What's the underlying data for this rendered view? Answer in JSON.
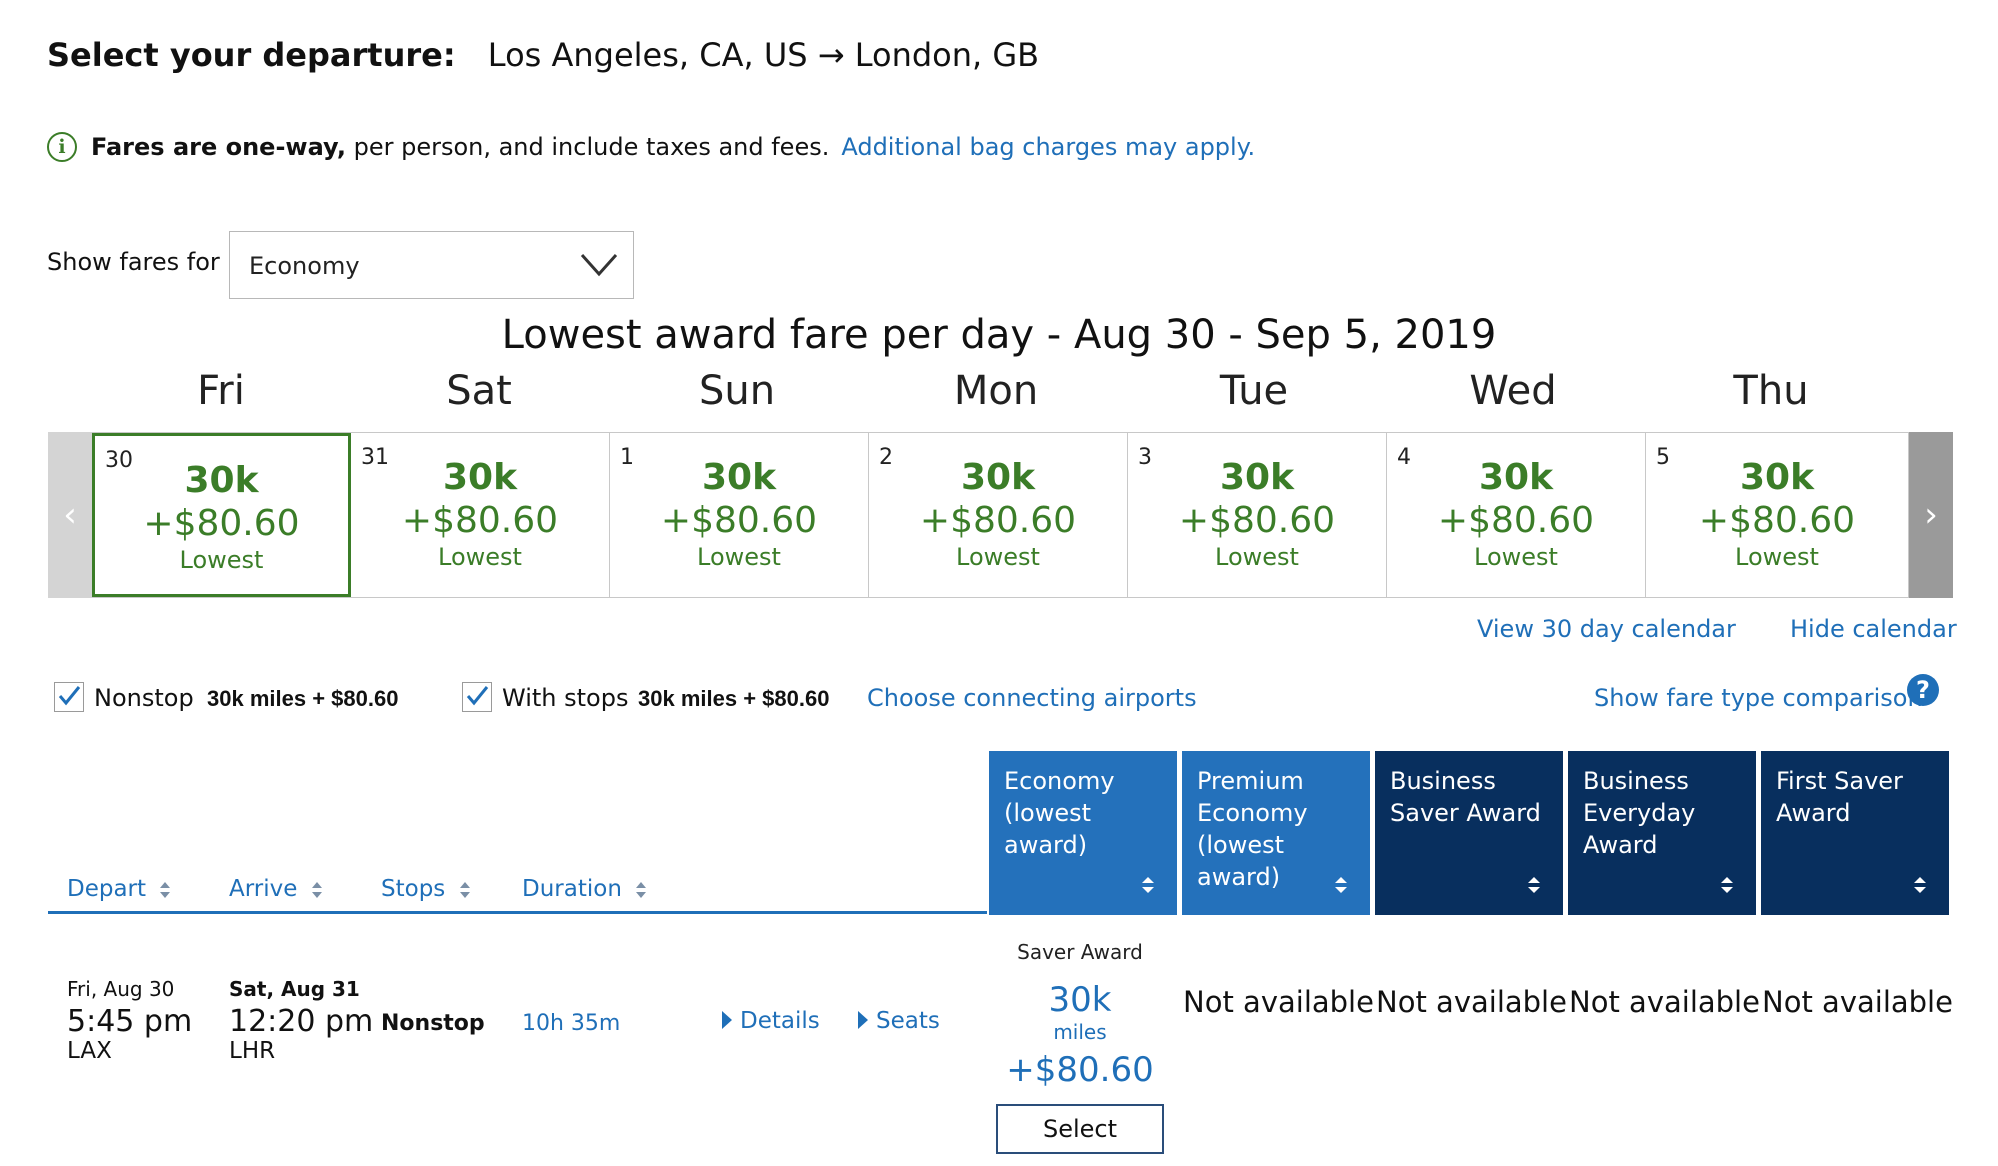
{
  "header": {
    "label": "Select your departure:",
    "route": "Los Angeles, CA, US → London, GB"
  },
  "info": {
    "bold": "Fares are one-way,",
    "text": " per person, and include taxes and fees.",
    "link": "Additional bag charges may apply."
  },
  "cabin": {
    "label": "Show fares for",
    "selected": "Economy"
  },
  "calendar": {
    "title": "Lowest award fare per day - Aug 30 - Sep 5, 2019",
    "days": [
      {
        "dow": "Fri",
        "date": "30",
        "miles": "30k",
        "fee": "+$80.60",
        "tag": "Lowest"
      },
      {
        "dow": "Sat",
        "date": "31",
        "miles": "30k",
        "fee": "+$80.60",
        "tag": "Lowest"
      },
      {
        "dow": "Sun",
        "date": "1",
        "miles": "30k",
        "fee": "+$80.60",
        "tag": "Lowest"
      },
      {
        "dow": "Mon",
        "date": "2",
        "miles": "30k",
        "fee": "+$80.60",
        "tag": "Lowest"
      },
      {
        "dow": "Tue",
        "date": "3",
        "miles": "30k",
        "fee": "+$80.60",
        "tag": "Lowest"
      },
      {
        "dow": "Wed",
        "date": "4",
        "miles": "30k",
        "fee": "+$80.60",
        "tag": "Lowest"
      },
      {
        "dow": "Thu",
        "date": "5",
        "miles": "30k",
        "fee": "+$80.60",
        "tag": "Lowest"
      }
    ],
    "prev_glyph": "‹",
    "next_glyph": "›",
    "view30": "View 30 day calendar",
    "hide": "Hide calendar"
  },
  "filters": {
    "nonstop_label": "Nonstop",
    "nonstop_value": "30k miles + $80.60",
    "stops_label": "With stops",
    "stops_value": "30k miles + $80.60",
    "connect_link": "Choose connecting airports",
    "compare_link": "Show fare type comparison",
    "help_glyph": "?"
  },
  "results": {
    "columns": [
      "Depart",
      "Arrive",
      "Stops",
      "Duration"
    ],
    "fare_columns": [
      {
        "lines": [
          "Economy",
          "(lowest",
          "award)"
        ],
        "theme": "light"
      },
      {
        "lines": [
          "Premium",
          "Economy",
          "(lowest",
          "award)"
        ],
        "theme": "light"
      },
      {
        "lines": [
          "Business",
          "Saver Award"
        ],
        "theme": "dark"
      },
      {
        "lines": [
          "Business",
          "Everyday",
          "Award"
        ],
        "theme": "dark"
      },
      {
        "lines": [
          "First Saver",
          "Award"
        ],
        "theme": "dark"
      }
    ],
    "flight": {
      "depart_date": "Fri, Aug 30",
      "depart_time": "5:45 pm",
      "depart_airport": "LAX",
      "arrive_date": "Sat, Aug 31",
      "arrive_time": "12:20 pm",
      "arrive_airport": "LHR",
      "stops": "Nonstop",
      "duration": "10h 35m",
      "details": "Details",
      "seats": "Seats",
      "fare_type": "Saver Award",
      "miles": "30k",
      "miles_unit": "miles",
      "fee": "+$80.60",
      "select": "Select",
      "not_available": [
        "Not available",
        "Not available",
        "Not available",
        "Not available"
      ]
    }
  },
  "colors": {
    "accent_blue": "#1f6fb8",
    "fare_green": "#3b7d28",
    "dark_navy": "#082f5e",
    "medium_blue": "#2471bb"
  }
}
